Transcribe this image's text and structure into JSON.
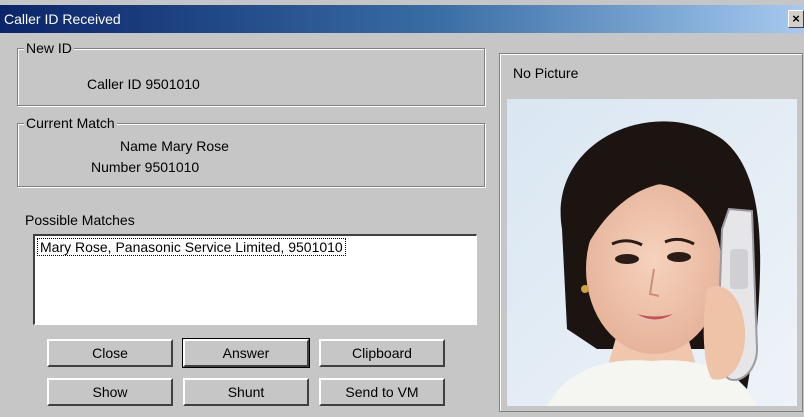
{
  "window": {
    "title": "Caller ID Received",
    "close_glyph": "×"
  },
  "new_id": {
    "legend": "New ID",
    "caller_id_text": "Caller ID 9501010"
  },
  "current_match": {
    "legend": "Current Match",
    "name_text": "Name Mary Rose",
    "number_text": "Number 9501010"
  },
  "possible_matches": {
    "label": "Possible Matches",
    "items": [
      "Mary Rose, Panasonic Service Limited, 9501010"
    ]
  },
  "buttons": {
    "close": "Close",
    "answer": "Answer",
    "clipboard": "Clipboard",
    "show": "Show",
    "shunt": "Shunt",
    "send_to_vm": "Send to VM"
  },
  "picture": {
    "caption": "No Picture"
  }
}
